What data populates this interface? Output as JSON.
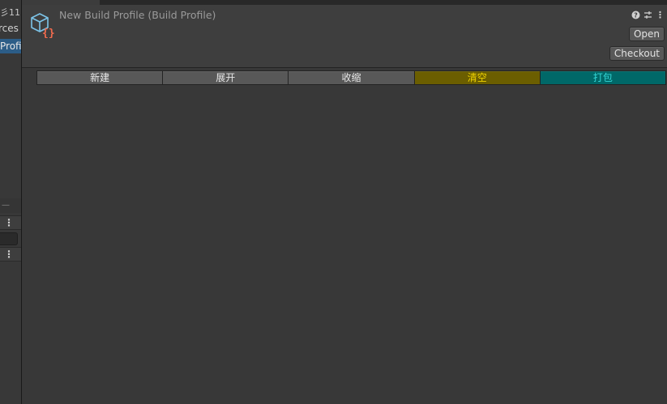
{
  "window": {
    "title": "New Build Profile (Build Profile)",
    "asset_icon": "build-profile-icon"
  },
  "left_panel": {
    "count": "彡11",
    "item1": "rces",
    "item2_selected": "Profi"
  },
  "header": {
    "icons": [
      "help-icon",
      "preset-icon",
      "more-options-icon"
    ],
    "open_label": "Open",
    "checkout_label": "Checkout"
  },
  "toolbar": {
    "buttons": [
      {
        "label": "新建",
        "name": "new-button"
      },
      {
        "label": "展开",
        "name": "expand-button"
      },
      {
        "label": "收缩",
        "name": "collapse-button"
      },
      {
        "label": "清空",
        "name": "clear-button",
        "color": "#6b5e00",
        "text_color": "#f0d400"
      },
      {
        "label": "打包",
        "name": "pack-button",
        "color": "#006868",
        "text_color": "#35d6d6"
      }
    ]
  },
  "colors": {
    "background": "#383838",
    "header": "#3e3e3e",
    "selection": "#2c5d87"
  }
}
